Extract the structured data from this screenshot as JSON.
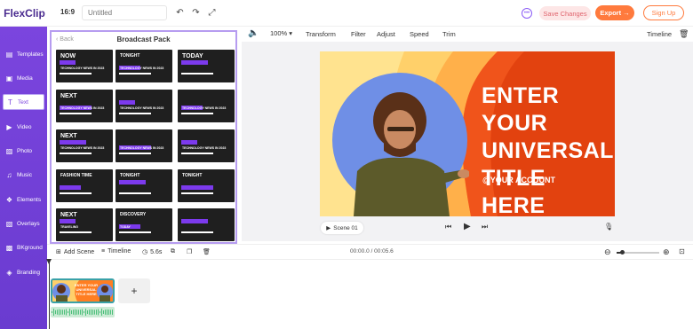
{
  "app": {
    "logo": "FlexClip",
    "ratio": "16:9",
    "title_placeholder": "Untitled"
  },
  "top_actions": {
    "save": "Save Changes",
    "export": "Export →",
    "signup": "Sign Up"
  },
  "sidebar": {
    "items": [
      {
        "label": "Templates",
        "icon": "templates-icon",
        "glyph": "▤"
      },
      {
        "label": "Media",
        "icon": "media-icon",
        "glyph": "▣"
      },
      {
        "label": "Text",
        "icon": "text-icon",
        "glyph": "T",
        "active": true
      },
      {
        "label": "Video",
        "icon": "video-icon",
        "glyph": "▶"
      },
      {
        "label": "Photo",
        "icon": "photo-icon",
        "glyph": "▨"
      },
      {
        "label": "Music",
        "icon": "music-icon",
        "glyph": "♫"
      },
      {
        "label": "Elements",
        "icon": "elements-icon",
        "glyph": "❖"
      },
      {
        "label": "Overlays",
        "icon": "overlays-icon",
        "glyph": "▧"
      },
      {
        "label": "BKground",
        "icon": "background-icon",
        "glyph": "▩"
      },
      {
        "label": "Branding",
        "icon": "branding-icon",
        "glyph": "◈"
      }
    ]
  },
  "panel": {
    "back": "Back",
    "title": "Broadcast Pack",
    "thumbs": [
      {
        "t1": "NOW",
        "t2": "TECHNOLOGY NEWS IN 2023"
      },
      {
        "t1": "TONIGHT",
        "t2": "TECHNOLOGY NEWS IN 2023"
      },
      {
        "t1": "TODAY",
        "t2": ""
      },
      {
        "t1": "NEXT",
        "t2": "TECHNOLOGY NEWS IN 2023"
      },
      {
        "t1": "",
        "t2": "TECHNOLOGY NEWS IN 2023"
      },
      {
        "t1": "",
        "t2": "TECHNOLOGY NEWS IN 2023"
      },
      {
        "t1": "NEXT",
        "t2": "TECHNOLOGY NEWS IN 2023"
      },
      {
        "t1": "",
        "t2": "TECHNOLOGY NEWS IN 2023"
      },
      {
        "t1": "",
        "t2": "TECHNOLOGY NEWS IN 2023"
      },
      {
        "t1": "FASHION TIME",
        "t2": ""
      },
      {
        "t1": "TONIGHT",
        "t2": ""
      },
      {
        "t1": "TONIGHT",
        "t2": ""
      },
      {
        "t1": "NEXT",
        "t2": "TRAVELING"
      },
      {
        "t1": "DISCOVERY",
        "t2": "TODAY"
      },
      {
        "t1": "",
        "t2": ""
      }
    ]
  },
  "toolbar": {
    "zoom": "100%",
    "transform": "Transform",
    "filter": "Filter",
    "adjust": "Adjust",
    "speed": "Speed",
    "trim": "Trim",
    "timeline": "Timeline"
  },
  "canvas": {
    "headline_1": "ENTER YOUR",
    "headline_2": "UNIVERSAL",
    "headline_3": "TITLE HERE",
    "account": "@YOUR ACCOUNT"
  },
  "player": {
    "scene": "Scene 01"
  },
  "timeline_bar": {
    "add_scene": "Add Scene",
    "timeline": "Timeline",
    "duration": "5.6s",
    "time": "00:00.0 / 00:05.6"
  },
  "clip": {
    "line1": "ENTER YOUR",
    "line2": "UNIVERSAL",
    "line3": "TITLE HERE"
  },
  "colors": {
    "brand_purple": "#7b45de",
    "export_orange": "#ff7a3d"
  }
}
